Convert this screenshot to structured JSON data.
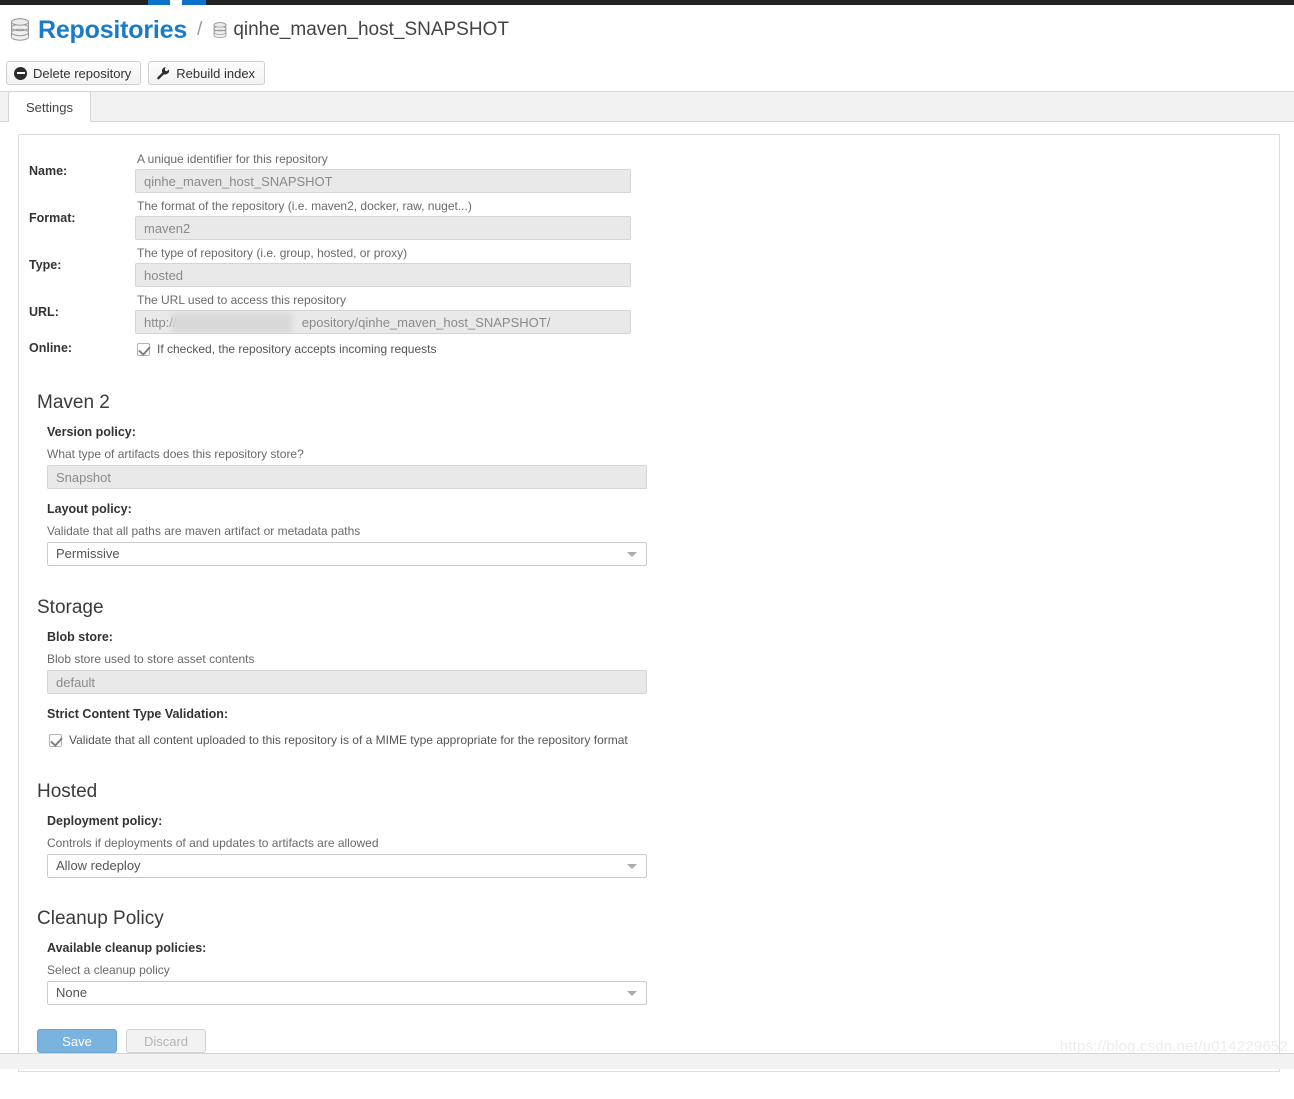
{
  "window": {
    "accent_blue": "#0b73c8",
    "link_blue": "#1a7bc9"
  },
  "breadcrumb": {
    "root_label": "Repositories",
    "separator": "/",
    "leaf_label": "qinhe_maven_host_SNAPSHOT",
    "root_icon": "database-icon",
    "leaf_icon": "database-icon"
  },
  "toolbar": {
    "delete_label": "Delete repository",
    "delete_icon": "minus-circle-icon",
    "rebuild_label": "Rebuild index",
    "rebuild_icon": "wrench-icon"
  },
  "tabs": [
    {
      "label": "Settings",
      "active": true
    }
  ],
  "settings": {
    "name": {
      "label": "Name:",
      "hint": "A unique identifier for this repository",
      "value": "qinhe_maven_host_SNAPSHOT"
    },
    "format": {
      "label": "Format:",
      "hint": "The format of the repository (i.e. maven2, docker, raw, nuget...)",
      "value": "maven2"
    },
    "type": {
      "label": "Type:",
      "hint": "The type of repository (i.e. group, hosted, or proxy)",
      "value": "hosted"
    },
    "url": {
      "label": "URL:",
      "hint": "The URL used to access this repository",
      "value_prefix": "http://n",
      "value_suffix": "epository/qinhe_maven_host_SNAPSHOT/"
    },
    "online": {
      "label": "Online:",
      "checkbox_text": "If checked, the repository accepts incoming requests",
      "checked": true
    }
  },
  "maven2": {
    "title": "Maven 2",
    "version_policy": {
      "label": "Version policy:",
      "hint": "What type of artifacts does this repository store?",
      "value": "Snapshot"
    },
    "layout_policy": {
      "label": "Layout policy:",
      "hint": "Validate that all paths are maven artifact or metadata paths",
      "value": "Permissive"
    }
  },
  "storage": {
    "title": "Storage",
    "blob_store": {
      "label": "Blob store:",
      "hint": "Blob store used to store asset contents",
      "value": "default"
    },
    "strict_validation": {
      "label": "Strict Content Type Validation:",
      "checkbox_text": "Validate that all content uploaded to this repository is of a MIME type appropriate for the repository format",
      "checked": true
    }
  },
  "hosted": {
    "title": "Hosted",
    "deployment_policy": {
      "label": "Deployment policy:",
      "hint": "Controls if deployments of and updates to artifacts are allowed",
      "value": "Allow redeploy"
    }
  },
  "cleanup": {
    "title": "Cleanup Policy",
    "available_policies": {
      "label": "Available cleanup policies:",
      "hint": "Select a cleanup policy",
      "value": "None"
    }
  },
  "actions": {
    "save_label": "Save",
    "discard_label": "Discard"
  },
  "watermark": {
    "text": "https://blog.csdn.net/u014229652"
  }
}
